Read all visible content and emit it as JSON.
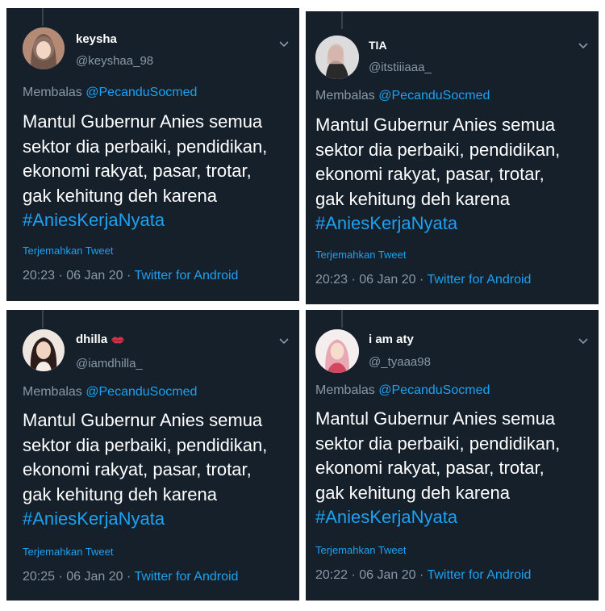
{
  "tweets": [
    {
      "name": "keysha",
      "handle": "@keyshaa_98",
      "reply_prefix": "Membalas",
      "reply_to": "@PecanduSocmed",
      "text": "Mantul Gubernur Anies semua\nsektor dia perbaiki, pendidikan,\nekonomi rakyat, pasar, trotar,\ngak kehitung deh karena",
      "hashtag": "#AniesKerjaNyata",
      "translate": "Terjemahkan Tweet",
      "time": "20:23 · 06 Jan 20 · ",
      "source": "Twitter for Android",
      "avatar_color": "#c9a48f",
      "emoji": ""
    },
    {
      "name": "TIA",
      "handle": "@itstiiiaaa_",
      "reply_prefix": "Membalas",
      "reply_to": "@PecanduSocmed",
      "text": "Mantul Gubernur Anies semua\nsektor dia perbaiki, pendidikan,\nekonomi rakyat, pasar, trotar,\ngak kehitung deh karena",
      "hashtag": "#AniesKerjaNyata",
      "translate": "Terjemahkan Tweet",
      "time": "20:23 · 06 Jan 20 · ",
      "source": "Twitter for Android",
      "avatar_color": "#d8d8d8",
      "emoji": ""
    },
    {
      "name": "dhilla",
      "handle": "@iamdhilla_",
      "reply_prefix": "Membalas",
      "reply_to": "@PecanduSocmed",
      "text": "Mantul Gubernur Anies semua\nsektor dia perbaiki, pendidikan,\nekonomi rakyat, pasar, trotar,\ngak kehitung deh karena",
      "hashtag": "#AniesKerjaNyata",
      "translate": "Terjemahkan Tweet",
      "time": "20:25 · 06 Jan 20 · ",
      "source": "Twitter for Android",
      "avatar_color": "#e8ddd6",
      "emoji": "lips"
    },
    {
      "name": "i am aty",
      "handle": "@_tyaaa98",
      "reply_prefix": "Membalas",
      "reply_to": "@PecanduSocmed",
      "text": "Mantul Gubernur Anies semua\nsektor dia perbaiki, pendidikan,\nekonomi rakyat, pasar, trotar,\ngak kehitung deh karena",
      "hashtag": "#AniesKerjaNyata",
      "translate": "Terjemahkan Tweet",
      "time": "20:22 · 06 Jan 20 · ",
      "source": "Twitter for Android",
      "avatar_color": "#f2ecea",
      "emoji": ""
    }
  ]
}
